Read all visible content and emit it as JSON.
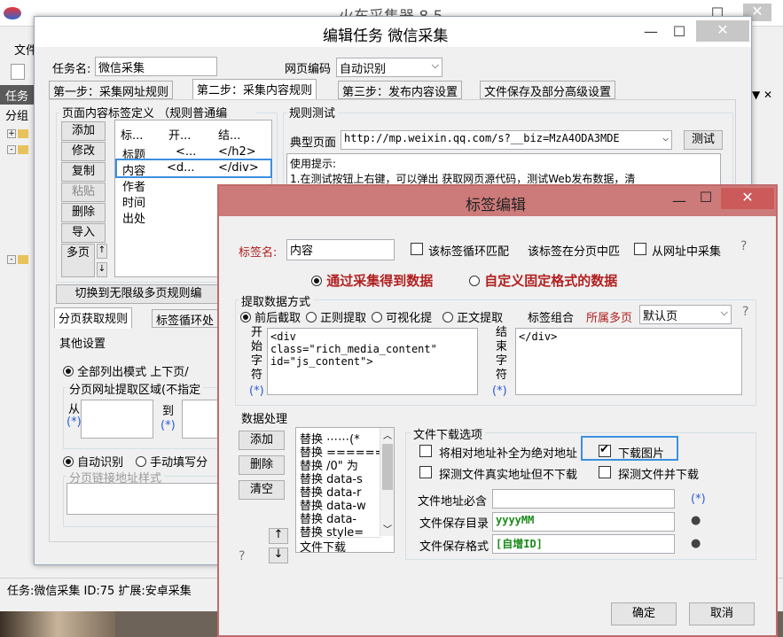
{
  "main_window": {
    "title": "火车采集器 8.5",
    "menu_file": "文件",
    "task_label": "任务",
    "group_label": "分组",
    "status_text": "任务:微信采集 ID:75 扩展:安卓采集"
  },
  "edit_task": {
    "title": "编辑任务 微信采集",
    "task_name_label": "任务名:",
    "task_name": "微信采集",
    "encoding_label": "网页编码",
    "encoding": "自动识别",
    "tabs": [
      "第一步：采集网址规则",
      "第二步：采集内容规则",
      "第三步：发布内容设置",
      "文件保存及部分高级设置"
    ],
    "tag_group_label": "页面内容标签定义 （规则普通编",
    "side_buttons": [
      "添加",
      "修改",
      "复制",
      "粘贴",
      "删除",
      "导入",
      "多页"
    ],
    "list_headers": [
      "标...",
      "开...",
      "结..."
    ],
    "list_rows": [
      [
        "标题",
        "<...",
        "</h2>"
      ],
      [
        "内容",
        "<d...",
        "</div>"
      ],
      [
        "作者",
        "",
        ""
      ],
      [
        "时间",
        "",
        ""
      ],
      [
        "出处",
        "",
        ""
      ]
    ],
    "rule_test_label": "规则测试",
    "typical_page_label": "典型页面",
    "typical_url": "http://mp.weixin.qq.com/s?__biz=MzA4ODA3MDE",
    "test_button": "测试",
    "tips_title": "使用提示:",
    "tips_line1": "1.在测试按钮上右键，可以弹出 获取网页源代码，测试Web发布数据，清",
    "switch_button": "切换到无限级多页规则编",
    "sub_tabs": [
      "分页获取规则",
      "标签循环处"
    ],
    "other_settings": "其他设置",
    "list_mode": "全部列出模式 上下页/",
    "page_area_label": "分页网址提取区域(不指定",
    "from_label": "从",
    "to_label": "到",
    "star": "(*)",
    "auto_identify": "自动识别",
    "manual": "手动填写分",
    "page_link_style": "分页链接地址样式"
  },
  "tag_edit": {
    "title": "标签编辑",
    "tag_name_label": "标签名:",
    "tag_name": "内容",
    "loop_match": "该标签循环匹配",
    "in_page_label": "该标签在分页中匹",
    "from_url": "从网址中采集",
    "mode_collect": "通过采集得到数据",
    "mode_fixed": "自定义固定格式的数据",
    "extract_method_label": "提取数据方式",
    "methods": [
      "前后截取",
      "正则提取",
      "可视化提",
      "正文提取"
    ],
    "tag_combo": "标签组合",
    "multipage_label": "所属多页",
    "multipage_value": "默认页",
    "start_label": "开始字符",
    "start_text": "<div\nclass=\"rich_media_content\"\nid=\"js_content\">",
    "end_label": "结束字符",
    "end_text": "</div>",
    "data_processing_label": "数据处理",
    "proc_buttons": [
      "添加",
      "删除",
      "清空"
    ],
    "proc_items": [
      "替换 ⋯⋯(*",
      "替换 ======",
      "替换 /0\" 为",
      "替换 data-s",
      "替换 data-r",
      "替换 data-w",
      "替换 data-",
      "替换 style=",
      "文件下载"
    ],
    "file_download_label": "文件下载选项",
    "relative_to_absolute": "将相对地址补全为绝对地址",
    "download_images": "下载图片",
    "detect_real_addr": "探测文件真实地址但不下载",
    "detect_and_download": "探测文件并下载",
    "addr_must_label": "文件地址必含",
    "save_dir_label": "文件保存目录",
    "save_dir": "yyyyMM",
    "save_format_label": "文件保存格式",
    "save_format": "[自增ID]",
    "ok_button": "确定",
    "cancel_button": "取消"
  }
}
